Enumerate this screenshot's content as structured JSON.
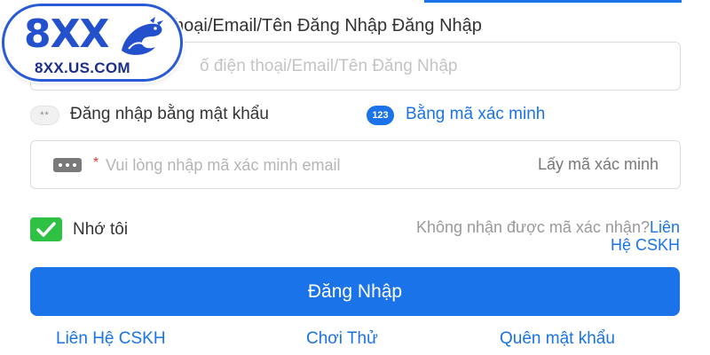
{
  "logo": {
    "mark": "8XX",
    "domain": "8XX.US.COM"
  },
  "login_form": {
    "username_label": "hoại/Email/Tên Đăng Nhập Đăng Nhập",
    "username_placeholder": "ố điện thoại/Email/Tên Đăng Nhập",
    "password_mode_icon": "**",
    "password_mode_label": "Đăng nhập bằng mật khẩu",
    "code_mode_icon": "123",
    "code_mode_label": "Bằng mã xác minh",
    "code_field_icon": "dots-icon",
    "required_mark": "*",
    "code_placeholder": "Vui lòng nhập mã xác minh email",
    "get_code_label": "Lấy mã xác minh",
    "remember_label": "Nhớ tôi",
    "remember_checked": true,
    "no_code_text": "Không nhận được mã xác nhận?",
    "contact_cs_inline": "Liên Hệ CSKH",
    "login_button": "Đăng Nhập"
  },
  "bottom_links": {
    "contact_cs": "Liên Hệ CSKH",
    "try_play": "Chơi Thử",
    "forgot_password": "Quên mật khẩu"
  },
  "colors": {
    "accent": "#1a73e8",
    "checkbox": "#2ec144",
    "logo_blue": "#2350cc"
  }
}
